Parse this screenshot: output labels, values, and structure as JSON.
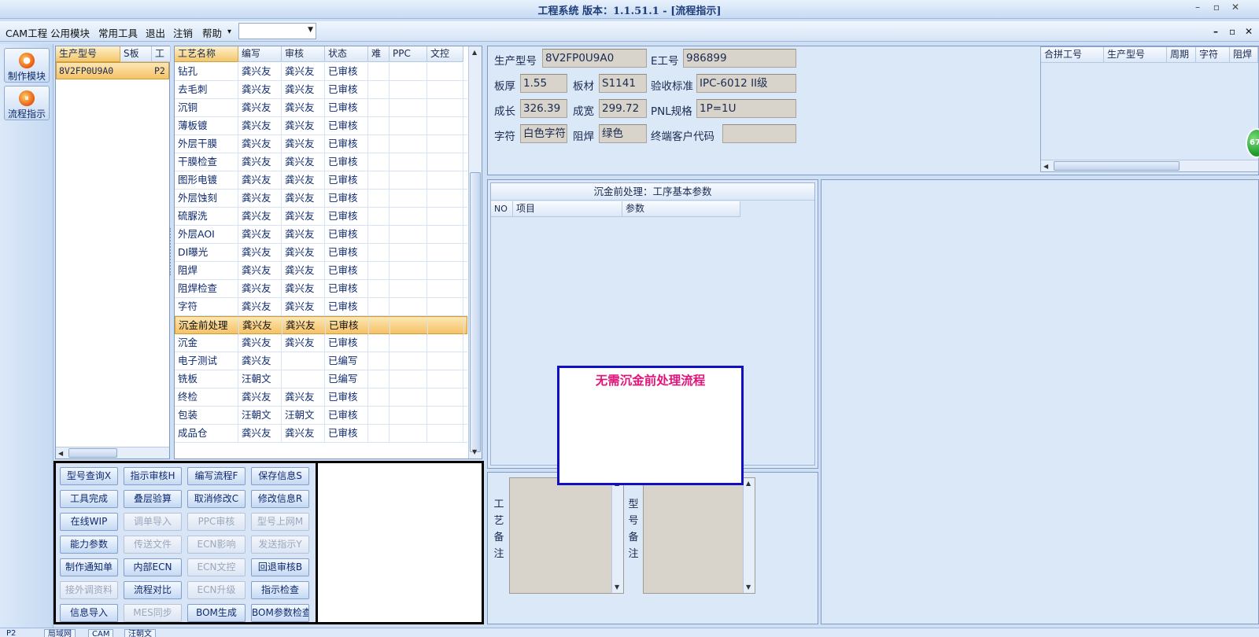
{
  "window": {
    "title": "工程系统  版本：1.1.51.1 - [流程指示]",
    "controls": [
      "–",
      "▫",
      "✕"
    ]
  },
  "menu": {
    "items": [
      "CAM工程",
      "公用模块",
      "常用工具",
      "退出",
      "注销",
      "帮助"
    ],
    "dropdown_marker": "▾",
    "combo_value": "",
    "mdi_controls": [
      "–",
      "▫",
      "✕"
    ]
  },
  "nav": {
    "items": [
      {
        "label": "制作模块",
        "icon": "flame-icon"
      },
      {
        "label": "流程指示",
        "icon": "flow-icon"
      }
    ]
  },
  "model_list": {
    "columns": [
      "生产型号",
      "S板",
      "工"
    ],
    "rows": [
      [
        "8V2FP0U9A0",
        "P2"
      ]
    ]
  },
  "process_table": {
    "columns": [
      "工艺名称",
      "编写",
      "审核",
      "状态",
      "难",
      "PPC",
      "文控"
    ],
    "selected_index": 14,
    "rows": [
      [
        "钻孔",
        "龚兴友",
        "龚兴友",
        "已审核"
      ],
      [
        "去毛刺",
        "龚兴友",
        "龚兴友",
        "已审核"
      ],
      [
        "沉铜",
        "龚兴友",
        "龚兴友",
        "已审核"
      ],
      [
        "薄板镀",
        "龚兴友",
        "龚兴友",
        "已审核"
      ],
      [
        "外层干膜",
        "龚兴友",
        "龚兴友",
        "已审核"
      ],
      [
        "干膜检查",
        "龚兴友",
        "龚兴友",
        "已审核"
      ],
      [
        "图形电镀",
        "龚兴友",
        "龚兴友",
        "已审核"
      ],
      [
        "外层蚀刻",
        "龚兴友",
        "龚兴友",
        "已审核"
      ],
      [
        "硫脲洗",
        "龚兴友",
        "龚兴友",
        "已审核"
      ],
      [
        "外层AOI",
        "龚兴友",
        "龚兴友",
        "已审核"
      ],
      [
        "DI曝光",
        "龚兴友",
        "龚兴友",
        "已审核"
      ],
      [
        "阻焊",
        "龚兴友",
        "龚兴友",
        "已审核"
      ],
      [
        "阻焊检查",
        "龚兴友",
        "龚兴友",
        "已审核"
      ],
      [
        "字符",
        "龚兴友",
        "龚兴友",
        "已审核"
      ],
      [
        "沉金前处理",
        "龚兴友",
        "龚兴友",
        "已审核"
      ],
      [
        "沉金",
        "龚兴友",
        "龚兴友",
        "已审核"
      ],
      [
        "电子测试",
        "龚兴友",
        "",
        "已编写"
      ],
      [
        "铣板",
        "汪朝文",
        "",
        "已编写"
      ],
      [
        "终检",
        "龚兴友",
        "龚兴友",
        "已审核"
      ],
      [
        "包装",
        "汪朝文",
        "汪朝文",
        "已审核"
      ],
      [
        "成品仓",
        "龚兴友",
        "龚兴友",
        "已审核"
      ]
    ]
  },
  "buttons": [
    [
      {
        "label": "型号查询X",
        "enabled": true
      },
      {
        "label": "指示审核H",
        "enabled": true
      },
      {
        "label": "编写流程F",
        "enabled": true
      },
      {
        "label": "保存信息S",
        "enabled": true
      }
    ],
    [
      {
        "label": "工具完成",
        "enabled": true
      },
      {
        "label": "叠层验算",
        "enabled": true
      },
      {
        "label": "取消修改C",
        "enabled": true
      },
      {
        "label": "修改信息R",
        "enabled": true
      }
    ],
    [
      {
        "label": "在线WIP",
        "enabled": true
      },
      {
        "label": "调单导入",
        "enabled": false
      },
      {
        "label": "PPC审核",
        "enabled": false
      },
      {
        "label": "型号上网M",
        "enabled": false
      }
    ],
    [
      {
        "label": "能力参数",
        "enabled": true
      },
      {
        "label": "传送文件",
        "enabled": false
      },
      {
        "label": "ECN影响",
        "enabled": false
      },
      {
        "label": "发送指示Y",
        "enabled": false
      }
    ],
    [
      {
        "label": "制作通知单",
        "enabled": true
      },
      {
        "label": "内部ECN",
        "enabled": true
      },
      {
        "label": "ECN文控",
        "enabled": false
      },
      {
        "label": "回退审核B",
        "enabled": true
      }
    ],
    [
      {
        "label": "接外调资料",
        "enabled": false
      },
      {
        "label": "流程对比",
        "enabled": true
      },
      {
        "label": "ECN升级",
        "enabled": false
      },
      {
        "label": "指示检查",
        "enabled": true
      }
    ],
    [
      {
        "label": "信息导入",
        "enabled": true
      },
      {
        "label": "MES同步",
        "enabled": false
      },
      {
        "label": "BOM生成",
        "enabled": true
      },
      {
        "label": "BOM参数检查",
        "enabled": true
      }
    ]
  ],
  "info": {
    "model_label": "生产型号",
    "model_value": "8V2FP0U9A0",
    "e_label": "E工号",
    "e_value": "986899",
    "thickness_label": "板厚",
    "thickness_value": "1.55",
    "material_label": "板材",
    "material_value": "S1141",
    "standard_label": "验收标准",
    "standard_value": "IPC-6012 II级",
    "length_label": "成长",
    "length_value": "326.39",
    "width_label": "成宽",
    "width_value": "299.72",
    "pnl_label": "PNL规格",
    "pnl_value": "1P=1U",
    "char_label": "字符",
    "char_value": "白色字符",
    "mask_label": "阻焊",
    "mask_value": "绿色",
    "customer_label": "终端客户代码",
    "customer_value": ""
  },
  "combine_table": {
    "columns": [
      "合拼工号",
      "生产型号",
      "周期",
      "字符",
      "阻焊"
    ]
  },
  "badge": "67",
  "params": {
    "title": "沉金前处理：工序基本参数",
    "columns": [
      "NO",
      "项目",
      "参数"
    ]
  },
  "popup": {
    "message": "无需沉金前处理流程"
  },
  "remarks": {
    "process_label": [
      "工",
      "艺",
      "备",
      "注"
    ],
    "model_label": [
      "型",
      "号",
      "备",
      "注"
    ]
  },
  "status_tabs": [
    "P2",
    "局域网",
    "CAM",
    "汪朝文"
  ],
  "colors": {
    "popup_text": "#e0157a",
    "popup_border": "#1010c0",
    "selected_row": "#f5c266",
    "header_gold": "#f3c76a"
  }
}
